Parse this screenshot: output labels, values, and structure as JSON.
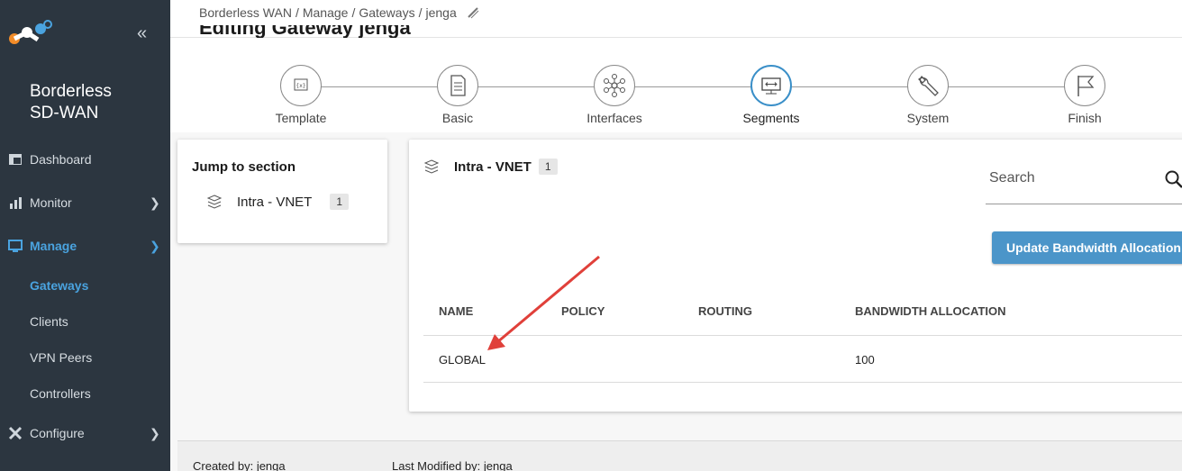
{
  "sidebar": {
    "brand": "Borderless SD-WAN",
    "brand_line1": "Borderless",
    "brand_line2": "SD-WAN",
    "collapse_icon": "double-chevron-left-icon",
    "nav": [
      {
        "label": "Dashboard",
        "icon": "dashboard-icon"
      },
      {
        "label": "Monitor",
        "icon": "chart-icon"
      },
      {
        "label": "Manage",
        "icon": "monitor-icon",
        "active": true
      },
      {
        "label": "Configure",
        "icon": "tools-icon"
      }
    ],
    "sub": [
      {
        "label": "Gateways",
        "active": true
      },
      {
        "label": "Clients"
      },
      {
        "label": "VPN Peers"
      },
      {
        "label": "Controllers"
      }
    ],
    "active_color": "#4aa3df",
    "bg_color": "#2c3640"
  },
  "header": {
    "breadcrumb": [
      "Borderless WAN",
      "Manage",
      "Gateways",
      "jenga"
    ],
    "separator": "/",
    "title": "Editing Gateway jenga"
  },
  "stepper": {
    "steps": [
      {
        "label": "Template",
        "icon": "template-icon"
      },
      {
        "label": "Basic",
        "icon": "document-icon"
      },
      {
        "label": "Interfaces",
        "icon": "network-icon"
      },
      {
        "label": "Segments",
        "icon": "segments-icon",
        "current": true
      },
      {
        "label": "System",
        "icon": "wrench-icon"
      },
      {
        "label": "Finish",
        "icon": "flag-icon"
      }
    ]
  },
  "jump": {
    "title": "Jump to section",
    "item_label": "Intra - VNET",
    "item_count": "1"
  },
  "segment": {
    "name": "Intra - VNET",
    "count": "1",
    "search_placeholder": "Search",
    "update_button": "Update Bandwidth Allocation",
    "button_color": "#4b95c9",
    "columns": [
      "NAME",
      "POLICY",
      "ROUTING",
      "BANDWIDTH ALLOCATION"
    ],
    "rows": [
      {
        "name": "GLOBAL",
        "policy": "",
        "routing": "",
        "bandwidth": "100"
      }
    ]
  },
  "footer": {
    "created_by": "Created by: jenga",
    "modified_by": "Last Modified by: jenga"
  },
  "annotation": {
    "color": "#e0403a",
    "icon": "red-arrow-annotation"
  }
}
